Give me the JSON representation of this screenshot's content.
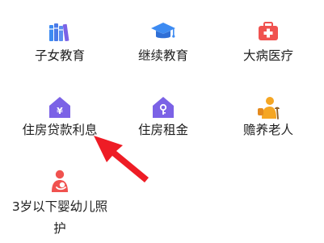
{
  "items": [
    {
      "id": "children-education",
      "label": "子女教育",
      "icon": "books-icon"
    },
    {
      "id": "continuing-education",
      "label": "继续教育",
      "icon": "graduation-cap-icon"
    },
    {
      "id": "serious-illness",
      "label": "大病医疗",
      "icon": "medical-kit-icon"
    },
    {
      "id": "housing-loan-interest",
      "label": "住房贷款利息",
      "icon": "house-yuan-icon"
    },
    {
      "id": "housing-rent",
      "label": "住房租金",
      "icon": "house-key-icon"
    },
    {
      "id": "elderly-support",
      "label": "赡养老人",
      "icon": "elderly-person-icon"
    },
    {
      "id": "infant-care",
      "label": "3岁以下婴幼儿照护",
      "icon": "mother-baby-icon"
    }
  ],
  "colors": {
    "blue": "#3d8bf2",
    "purple": "#7b62e6",
    "red": "#f0524f",
    "orange": "#f5a623",
    "arrow": "#ee1c25"
  }
}
